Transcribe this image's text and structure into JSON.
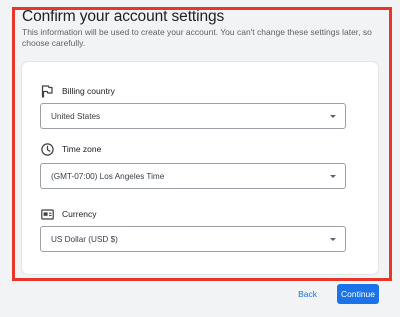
{
  "header": {
    "title": "Confirm your account settings",
    "subtitle": "This information will be used to create your account. You can't change these settings later, so choose carefully."
  },
  "sections": [
    {
      "label": "Billing country",
      "icon": "flag-icon",
      "value": "United States"
    },
    {
      "label": "Time zone",
      "icon": "clock-icon",
      "value": "(GMT-07:00) Los Angeles Time"
    },
    {
      "label": "Currency",
      "icon": "currency-icon",
      "value": "US Dollar (USD $)"
    }
  ],
  "actions": {
    "back_label": "Back",
    "continue_label": "Continue"
  },
  "colors": {
    "accent": "#1a73e8",
    "highlight_border": "#e8362a"
  }
}
